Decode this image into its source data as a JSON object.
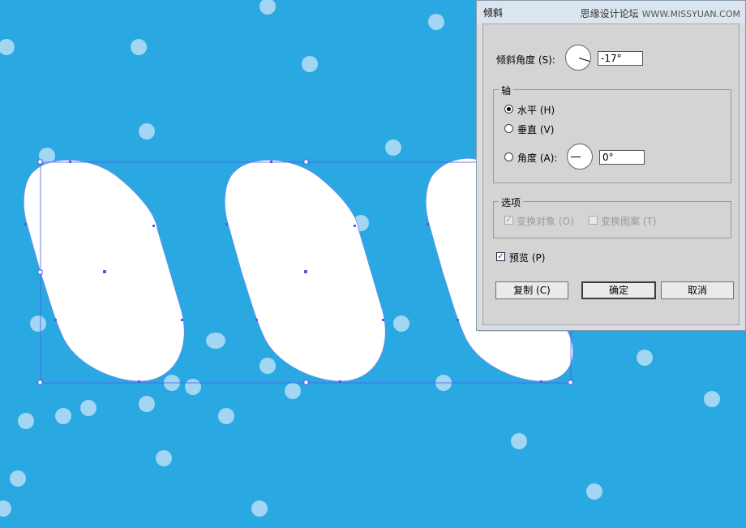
{
  "dialog": {
    "title": "倾斜",
    "watermark_cn": "思缘设计论坛",
    "watermark_url": "WWW.MISSYUAN.COM",
    "shear_angle_label": "倾斜角度 (S):",
    "shear_angle_value": "-17°",
    "axis_legend": "轴",
    "axis_horizontal": "水平 (H)",
    "axis_vertical": "垂直 (V)",
    "axis_angle": "角度 (A):",
    "axis_angle_value": "0°",
    "options_legend": "选项",
    "transform_objects": "变换对象 (O)",
    "transform_patterns": "变换图案 (T)",
    "preview": "预览 (P)",
    "copy_button": "复制 (C)",
    "ok_button": "确定",
    "cancel_button": "取消"
  },
  "state": {
    "axis_selected": "horizontal",
    "transform_objects_checked": true,
    "transform_patterns_checked": false,
    "preview_checked": true
  },
  "colors": {
    "canvas_bg": "#29a8e2",
    "bubble": "#b7def4",
    "shape_fill": "#ffffff",
    "selection": "#4a63e0"
  }
}
